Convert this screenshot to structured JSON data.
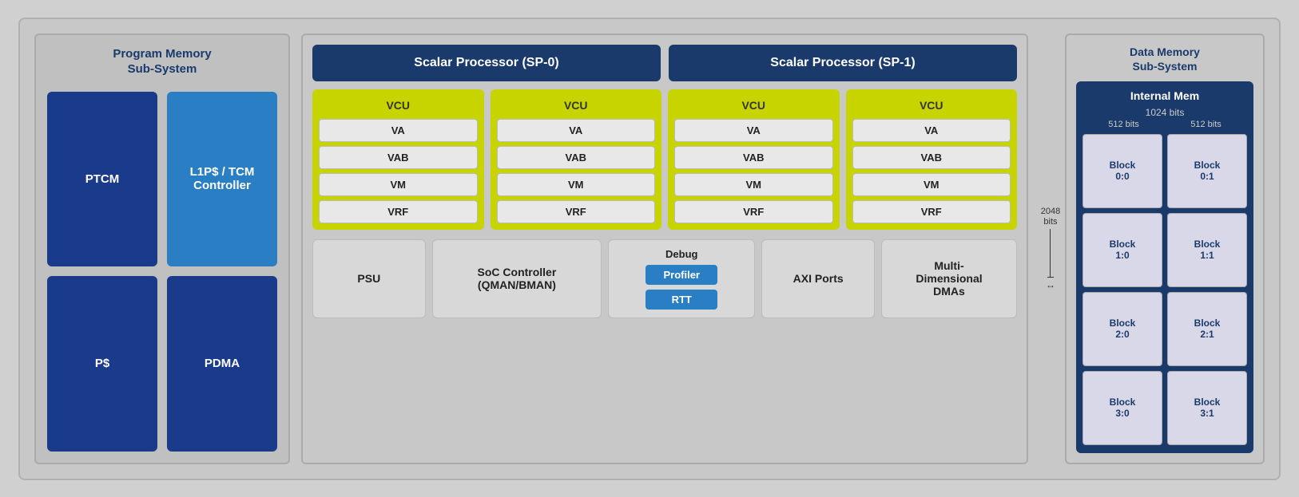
{
  "left": {
    "title": "Program Memory\nSub-System",
    "blocks": [
      {
        "id": "ptcm",
        "label": "PTCM",
        "style": "dark"
      },
      {
        "id": "l1ps-tcm",
        "label": "L1P$ / TCM\nController",
        "style": "light"
      },
      {
        "id": "ps",
        "label": "P$",
        "style": "dark"
      },
      {
        "id": "pdma",
        "label": "PDMA",
        "style": "dark"
      }
    ]
  },
  "middle": {
    "sp0": {
      "label": "Scalar Processor (SP-0)"
    },
    "sp1": {
      "label": "Scalar Processor (SP-1)"
    },
    "vcus": [
      {
        "header": "VCU",
        "items": [
          "VA",
          "VAB",
          "VM",
          "VRF"
        ]
      },
      {
        "header": "VCU",
        "items": [
          "VA",
          "VAB",
          "VM",
          "VRF"
        ]
      },
      {
        "header": "VCU",
        "items": [
          "VA",
          "VAB",
          "VM",
          "VRF"
        ]
      },
      {
        "header": "VCU",
        "items": [
          "VA",
          "VAB",
          "VM",
          "VRF"
        ]
      }
    ],
    "bottom": [
      {
        "id": "psu",
        "label": "PSU"
      },
      {
        "id": "soc-ctrl",
        "label": "SoC Controller\n(QMAN/BMAN)"
      },
      {
        "id": "debug",
        "type": "debug",
        "title": "Debug",
        "btns": [
          "Profiler",
          "RTT"
        ]
      },
      {
        "id": "axi",
        "label": "AXI Ports"
      },
      {
        "id": "dma",
        "label": "Multi-\nDimensional\nDMAs"
      }
    ]
  },
  "right": {
    "title": "Data Memory\nSub-System",
    "internal_mem_title": "Internal Mem",
    "bits_2048": "2048\nbits",
    "bits_1024": "1024 bits",
    "bits_512_left": "512 bits",
    "bits_512_right": "512 bits",
    "blocks": [
      {
        "label": "Block\n0:0"
      },
      {
        "label": "Block\n0:1"
      },
      {
        "label": "Block\n1:0"
      },
      {
        "label": "Block\n1:1"
      },
      {
        "label": "Block\n2:0"
      },
      {
        "label": "Block\n2:1"
      },
      {
        "label": "Block\n3:0"
      },
      {
        "label": "Block\n3:1"
      }
    ]
  }
}
